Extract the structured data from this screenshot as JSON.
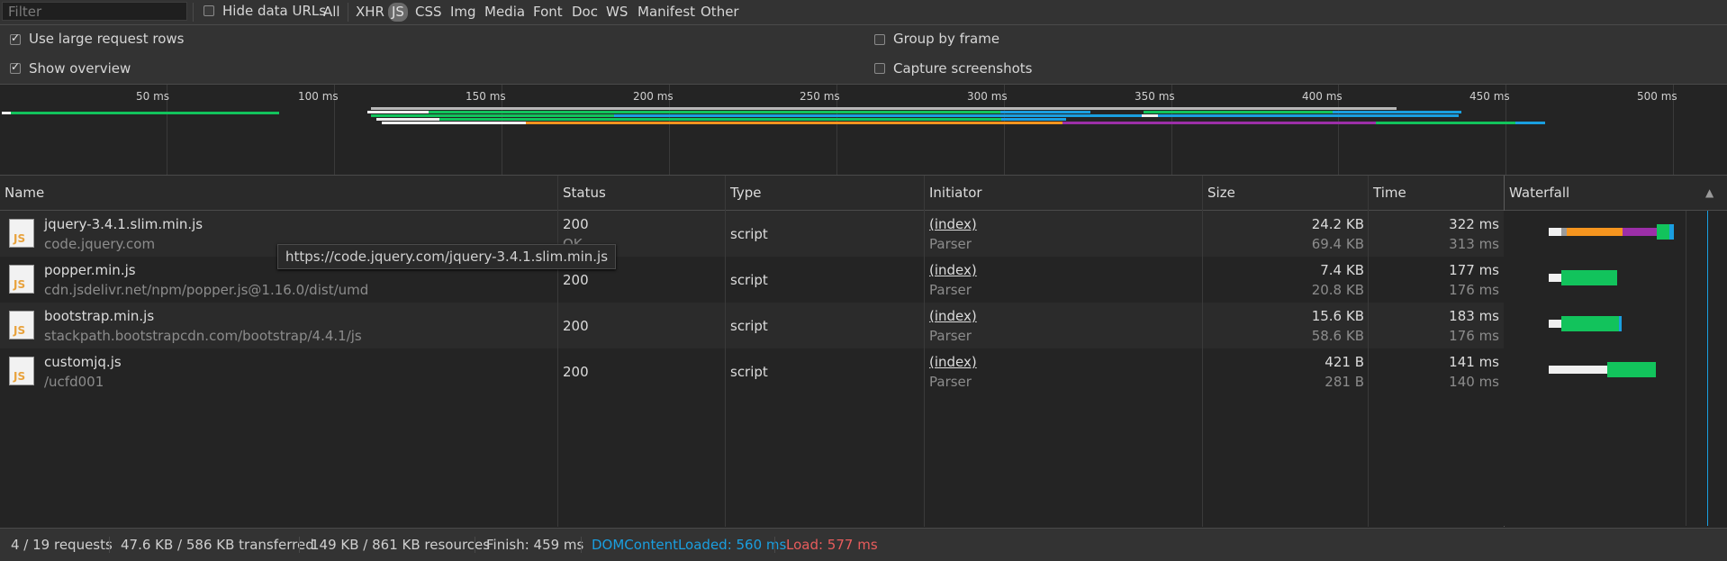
{
  "filter": {
    "placeholder": "Filter",
    "value": ""
  },
  "toolbar": {
    "hide_data_urls": {
      "label": "Hide data URLs",
      "checked": false
    },
    "types": [
      "All",
      "XHR",
      "JS",
      "CSS",
      "Img",
      "Media",
      "Font",
      "Doc",
      "WS",
      "Manifest",
      "Other"
    ],
    "active_type": "JS"
  },
  "settings": {
    "large_rows": {
      "label": "Use large request rows",
      "checked": true
    },
    "overview": {
      "label": "Show overview",
      "checked": true
    },
    "group_by_frame": {
      "label": "Group by frame",
      "checked": false
    },
    "capture_screenshots": {
      "label": "Capture screenshots",
      "checked": false
    }
  },
  "overview": {
    "ticks": [
      "50 ms",
      "100 ms",
      "150 ms",
      "200 ms",
      "250 ms",
      "300 ms",
      "350 ms",
      "400 ms",
      "450 ms",
      "500 ms"
    ]
  },
  "columns": [
    "Name",
    "Status",
    "Type",
    "Initiator",
    "Size",
    "Time",
    "Waterfall"
  ],
  "sort_indicator": "▲",
  "rows": [
    {
      "name": "jquery-3.4.1.slim.min.js",
      "path": "code.jquery.com",
      "status": "200",
      "status_text": "OK",
      "type": "script",
      "initiator": "(index)",
      "initiator_type": "Parser",
      "size": "24.2 KB",
      "resource_size": "69.4 KB",
      "time": "322 ms",
      "latency": "313 ms",
      "icon": "JS"
    },
    {
      "name": "popper.min.js",
      "path": "cdn.jsdelivr.net/npm/popper.js@1.16.0/dist/umd",
      "status": "200",
      "status_text": "",
      "type": "script",
      "initiator": "(index)",
      "initiator_type": "Parser",
      "size": "7.4 KB",
      "resource_size": "20.8 KB",
      "time": "177 ms",
      "latency": "176 ms",
      "icon": "JS"
    },
    {
      "name": "bootstrap.min.js",
      "path": "stackpath.bootstrapcdn.com/bootstrap/4.4.1/js",
      "status": "200",
      "status_text": "",
      "type": "script",
      "initiator": "(index)",
      "initiator_type": "Parser",
      "size": "15.6 KB",
      "resource_size": "58.6 KB",
      "time": "183 ms",
      "latency": "176 ms",
      "icon": "JS"
    },
    {
      "name": "customjq.js",
      "path": "/ucfd001",
      "status": "200",
      "status_text": "",
      "type": "script",
      "initiator": "(index)",
      "initiator_type": "Parser",
      "size": "421 B",
      "resource_size": "281 B",
      "time": "141 ms",
      "latency": "140 ms",
      "icon": "JS"
    }
  ],
  "tooltip": "https://code.jquery.com/jquery-3.4.1.slim.min.js",
  "status_bar": {
    "requests": "4 / 19 requests",
    "transferred": "47.6 KB / 586 KB transferred",
    "resources": "149 KB / 861 KB resources",
    "finish": "Finish: 459 ms",
    "dom_content_loaded": "DOMContentLoaded: 560 ms",
    "load": "Load: 577 ms"
  },
  "colors": {
    "blue": "#1a9fe0",
    "red": "#e85c5c",
    "green": "#12c35c",
    "orange": "#f5951f",
    "purple": "#9c2fa8",
    "white": "#f0f0f0"
  }
}
